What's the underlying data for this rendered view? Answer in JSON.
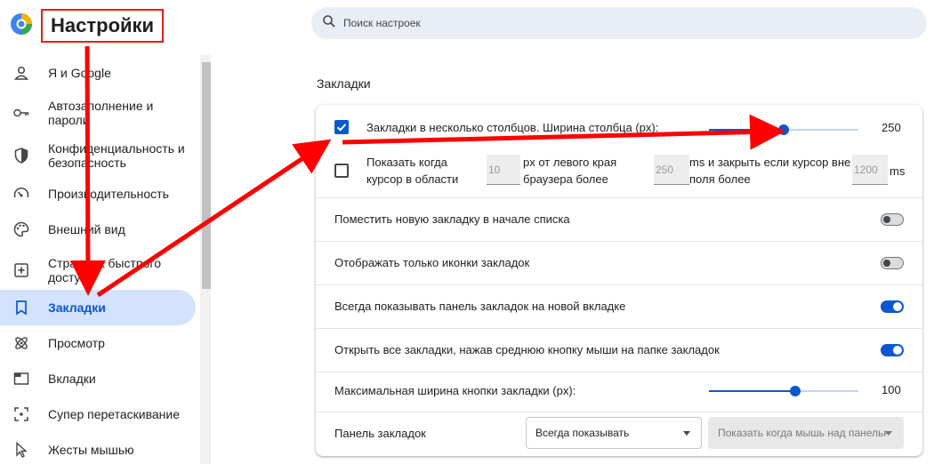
{
  "header": {
    "app_title": "Настройки",
    "search_placeholder": "Поиск настроек"
  },
  "sidebar": {
    "items": [
      {
        "label": "Я и Google",
        "icon": "person-icon",
        "active": false
      },
      {
        "label": "Автозаполнение и пароли",
        "icon": "key-icon",
        "active": false
      },
      {
        "label": "Конфиденциальность и безопасность",
        "icon": "shield-icon",
        "active": false
      },
      {
        "label": "Производительность",
        "icon": "speedometer-icon",
        "active": false
      },
      {
        "label": "Внешний вид",
        "icon": "palette-icon",
        "active": false
      },
      {
        "label": "Страница быстрого доступа",
        "icon": "speed-dial-icon",
        "active": false
      },
      {
        "label": "Закладки",
        "icon": "bookmark-icon",
        "active": true
      },
      {
        "label": "Просмотр",
        "icon": "atom-icon",
        "active": false
      },
      {
        "label": "Вкладки",
        "icon": "tab-icon",
        "active": false
      },
      {
        "label": "Супер перетаскивание",
        "icon": "drag-target-icon",
        "active": false
      },
      {
        "label": "Жесты мышью",
        "icon": "cursor-icon",
        "active": false
      }
    ]
  },
  "section": {
    "title": "Закладки",
    "columns": {
      "label": "Закладки в несколько столбцов. Ширина столбца (px):",
      "checked": true,
      "value": "250",
      "slider_fraction": 0.5
    },
    "hover": {
      "checked": false,
      "text1": "Показать когда курсор в области",
      "value1": "10",
      "text2": "px от левого края браузера более",
      "value2": "250",
      "text3": "ms и закрыть если курсор вне поля более",
      "value3": "1200",
      "text4": "ms"
    },
    "toggles": [
      {
        "label": "Поместить новую закладку в начале списка",
        "on": false
      },
      {
        "label": "Отображать только иконки закладок",
        "on": false
      },
      {
        "label": "Всегда показывать панель закладок на новой вкладке",
        "on": true
      },
      {
        "label": "Открыть все закладки, нажав среднюю кнопку мыши на папке закладок",
        "on": true
      }
    ],
    "max_width": {
      "label": "Максимальная ширина кнопки закладки (px):",
      "value": "100",
      "slider_fraction": 0.58
    },
    "bar": {
      "label": "Панель закладок",
      "select_value": "Всегда показывать",
      "disabled_select_value": "Показать когда мышь над панелью"
    }
  },
  "colors": {
    "accent": "#0b57d0",
    "active_bg": "#d3e3fd",
    "annotation": "#ff0000"
  }
}
